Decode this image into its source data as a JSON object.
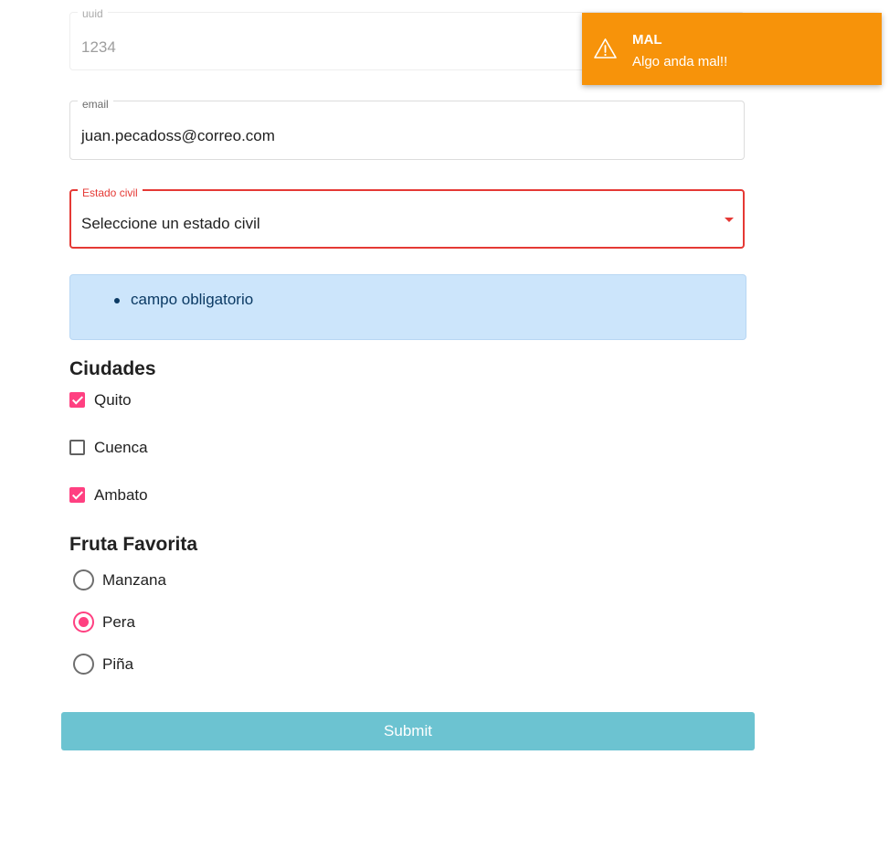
{
  "form": {
    "uuid": {
      "label": "uuid",
      "value": "1234"
    },
    "email": {
      "label": "email",
      "value": "juan.pecadoss@correo.com"
    },
    "estado_civil": {
      "label": "Estado civil",
      "value": "Seleccione un estado civil"
    },
    "validation": {
      "errors": [
        "campo obligatorio"
      ]
    },
    "ciudades": {
      "title": "Ciudades",
      "options": [
        {
          "label": "Quito",
          "checked": true
        },
        {
          "label": "Cuenca",
          "checked": false
        },
        {
          "label": "Ambato",
          "checked": true
        }
      ]
    },
    "fruta": {
      "title": "Fruta Favorita",
      "options": [
        {
          "label": "Manzana",
          "selected": false
        },
        {
          "label": "Pera",
          "selected": true
        },
        {
          "label": "Piña",
          "selected": false
        }
      ]
    },
    "submit_label": "Submit"
  },
  "toast": {
    "title": "MAL",
    "message": "Algo anda mal!!",
    "icon": "warning-icon"
  },
  "colors": {
    "accent": "#ff4081",
    "error": "#e53935",
    "info_bg": "#cce5fb",
    "submit_bg": "#6cc3d1",
    "toast_bg": "#f7930a"
  }
}
